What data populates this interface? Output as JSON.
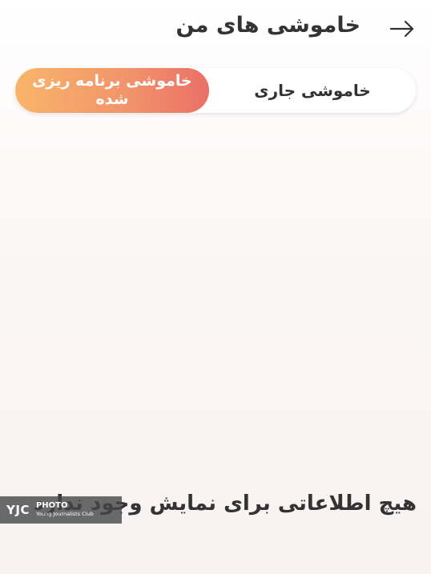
{
  "header": {
    "title": "خاموشی های من",
    "back_icon": "arrow-right-icon"
  },
  "tabs": [
    {
      "label": "خاموشی جاری",
      "active": false
    },
    {
      "label": "خاموشی برنامه ریزی شده",
      "active": true
    }
  ],
  "empty_state": {
    "message": "هیچ اطلاعاتی برای نمایش وجود ندارد"
  },
  "watermark": {
    "logo": "YJC",
    "label": "PHOTO",
    "sub": "Young Journalists Club"
  },
  "colors": {
    "active_tab_gradient_start": "#f9b56a",
    "active_tab_gradient_end": "#ea7067",
    "text": "#333333"
  }
}
